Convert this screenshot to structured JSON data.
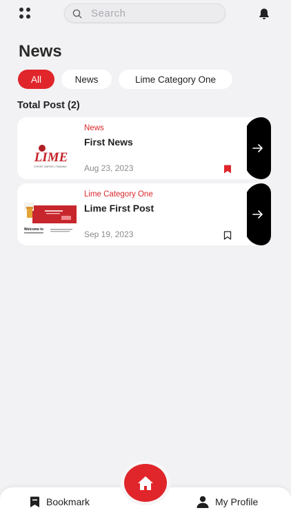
{
  "search": {
    "placeholder": "Search"
  },
  "page": {
    "title": "News",
    "total_label": "Total Post (2)"
  },
  "filters": [
    {
      "label": "All",
      "active": true
    },
    {
      "label": "News",
      "active": false
    },
    {
      "label": "Lime Category One",
      "active": false
    }
  ],
  "posts": [
    {
      "category": "News",
      "title": "First News",
      "date": "Aug 23, 2023",
      "bookmarked": true,
      "logo_text": "LIME",
      "logo_tagline": "EXPORT | IMPORT | TRAINING"
    },
    {
      "category": "Lime Category One",
      "title": "Lime First Post",
      "date": "Sep 19, 2023",
      "bookmarked": false,
      "thumb_text": "Welcome to"
    }
  ],
  "bottom_nav": {
    "bookmark_label": "Bookmark",
    "profile_label": "My Profile"
  },
  "colors": {
    "accent": "#e0262b",
    "background": "#f2f1f3",
    "card": "#ffffff",
    "arrow_tab": "#000000"
  },
  "icons": [
    "apps-grid-icon",
    "search-icon",
    "bell-icon",
    "bookmark-icon",
    "arrow-right-icon",
    "home-icon",
    "user-icon"
  ]
}
